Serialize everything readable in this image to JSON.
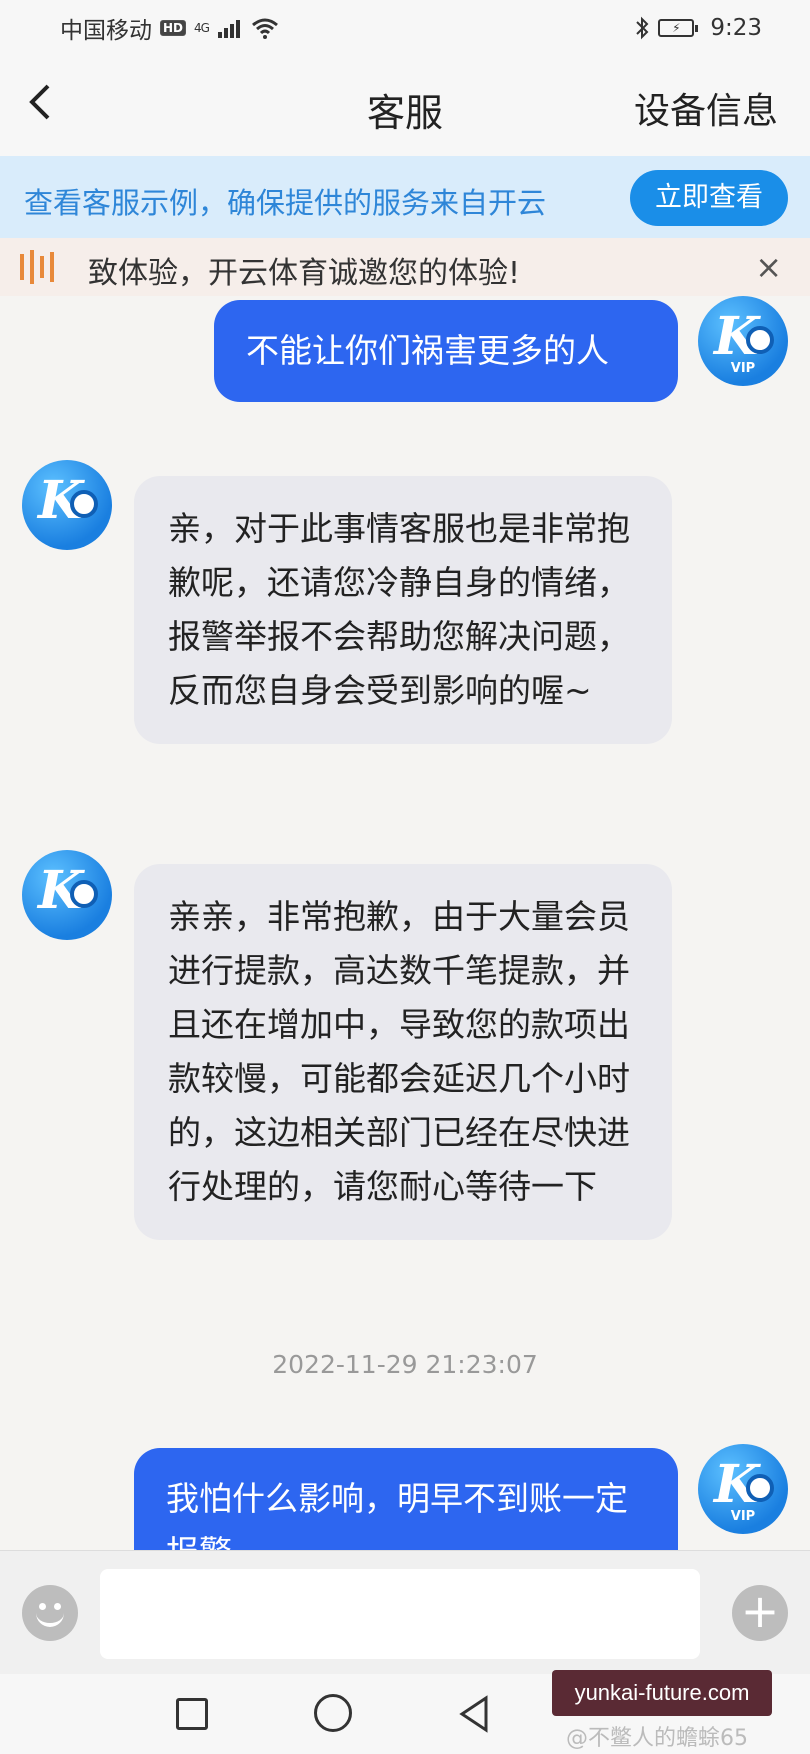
{
  "status_bar": {
    "carrier": "中国移动",
    "hd": "HD",
    "network": "4G",
    "time": "9:23"
  },
  "header": {
    "title": "客服",
    "device_info": "设备信息"
  },
  "notice": {
    "text": "查看客服示例，确保提供的服务来自开云",
    "button": "立即查看"
  },
  "marquee": {
    "text": "致体验，开云体育诚邀您的体验!",
    "close": "×"
  },
  "messages": [
    {
      "from": "user",
      "text": "不能让你们祸害更多的人",
      "avatar_badge": "VIP"
    },
    {
      "from": "agent",
      "text": "亲，对于此事情客服也是非常抱歉呢，还请您冷静自身的情绪，报警举报不会帮助您解决问题，反而您自身会受到影响的喔~"
    },
    {
      "from": "agent",
      "text": "亲亲，非常抱歉，由于大量会员进行提款，高达数千笔提款，并且还在增加中，导致您的款项出款较慢，可能都会延迟几个小时的，这边相关部门已经在尽快进行处理的，请您耐心等待一下"
    },
    {
      "from": "user",
      "text": "我怕什么影响，明早不到账一定报警",
      "avatar_badge": "VIP"
    }
  ],
  "timestamp": "2022-11-29 21:23:07",
  "input": {
    "placeholder": ""
  },
  "watermark": {
    "site": "yunkai-future.com",
    "author": "@不鳖人的蟾蜍65"
  },
  "icons": [
    "back-arrow-icon",
    "marquee-sound-icon",
    "close-icon",
    "emoji-icon",
    "plus-icon",
    "nav-square-icon",
    "nav-home-icon",
    "nav-back-icon"
  ]
}
